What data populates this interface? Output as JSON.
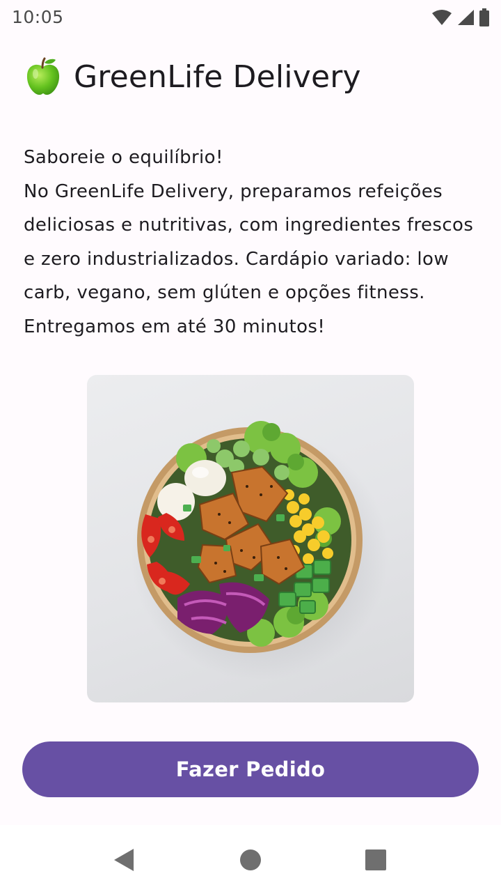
{
  "status_bar": {
    "time": "10:05",
    "icons": [
      "wifi-icon",
      "signal-icon",
      "battery-icon"
    ]
  },
  "header": {
    "icon": "green-apple-icon",
    "title": "GreenLife Delivery"
  },
  "description": {
    "lines": [
      "Saboreie o equilíbrio!",
      "No GreenLife Delivery, preparamos refeições",
      "deliciosas e nutritivas, com ingredientes frescos",
      "e zero industrializados. Cardápio variado: low",
      "carb, vegano, sem glúten e opções fitness.",
      "Entregamos em até 30 minutos!"
    ]
  },
  "image": {
    "subject": "salad-bowl"
  },
  "order_button": {
    "label": "Fazer Pedido"
  },
  "nav_bar": {
    "buttons": [
      "back-icon",
      "home-icon",
      "recents-icon"
    ]
  },
  "colors": {
    "primary": "#6750a4",
    "background": "#fffbfe",
    "on_primary": "#ffffff",
    "text": "#1d1b20"
  }
}
